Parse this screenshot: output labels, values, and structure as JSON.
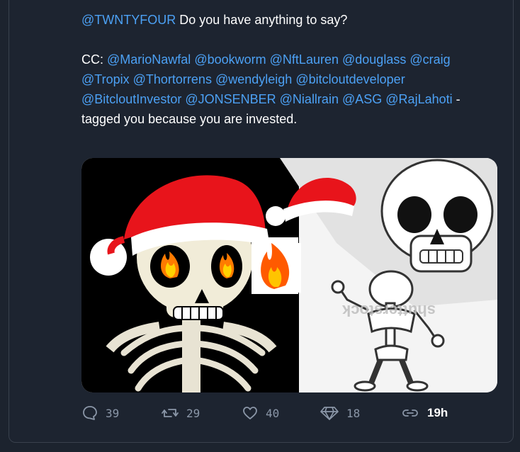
{
  "post": {
    "lead_mention": "@TWNTYFOUR",
    "lead_text": " Do you have anything to say?",
    "cc_label": "CC: ",
    "mentions": [
      "@MarioNawfal",
      "@bookworm",
      "@NftLauren",
      "@douglass",
      "@craig",
      "@Tropix",
      "@Thortorrens",
      "@wendyleigh",
      "@bitcloutdeveloper",
      "@BitcloutInvestor",
      "@JONSENBER",
      "@Niallrain",
      "@ASG",
      "@RajLahoti"
    ],
    "tail_text": " - tagged you because you are invested."
  },
  "media": {
    "watermark": "shutterstock"
  },
  "actions": {
    "comments": "39",
    "reposts": "29",
    "likes": "40",
    "diamonds": "18",
    "time": "19h"
  },
  "colors": {
    "background": "#1c232e",
    "mention": "#4ca1f5",
    "icon": "#8b97a8"
  }
}
